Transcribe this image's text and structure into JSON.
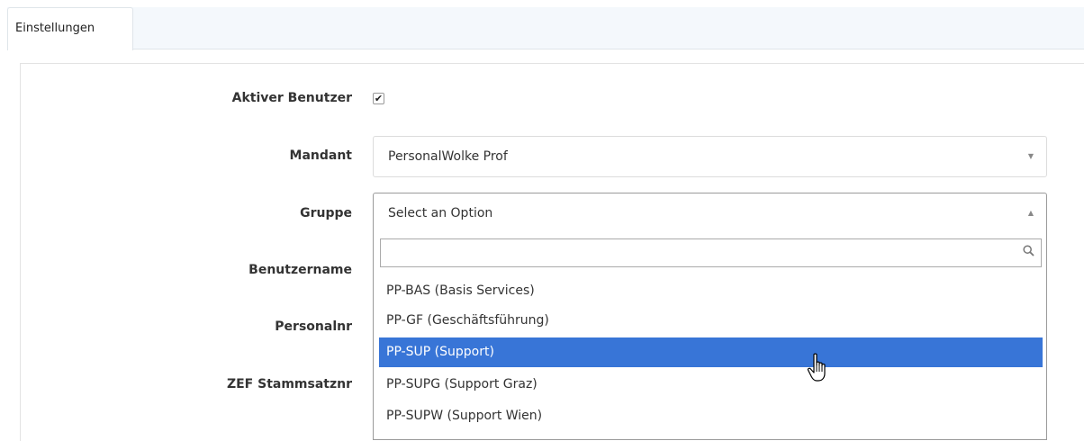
{
  "tabs": [
    {
      "label": "Einstellungen"
    }
  ],
  "form": {
    "aktiver_benutzer": {
      "label": "Aktiver Benutzer",
      "checked": true,
      "check_glyph": "✔"
    },
    "mandant": {
      "label": "Mandant",
      "value": "PersonalWolke Prof"
    },
    "gruppe": {
      "label": "Gruppe",
      "value": "Select an Option"
    },
    "benutzername": {
      "label": "Benutzername"
    },
    "personalnr": {
      "label": "Personalnr"
    },
    "zef": {
      "label": "ZEF Stammsatznr"
    }
  },
  "dropdown": {
    "search_placeholder": "",
    "options": [
      {
        "label": "PP-BAS (Basis Services)"
      },
      {
        "label": "PP-GF (Geschäftsführung)"
      },
      {
        "label": "PP-SUP (Support)",
        "highlighted": true
      },
      {
        "label": "PP-SUPG (Support Graz)"
      },
      {
        "label": "PP-SUPW (Support Wien)"
      }
    ]
  },
  "icons": {
    "select_down": "▼",
    "select_up": "▲",
    "search": "search-icon",
    "cursor": "hand-pointer-icon"
  },
  "colors": {
    "highlight": "#3875d7",
    "tabbar": "#f4f8fc"
  }
}
